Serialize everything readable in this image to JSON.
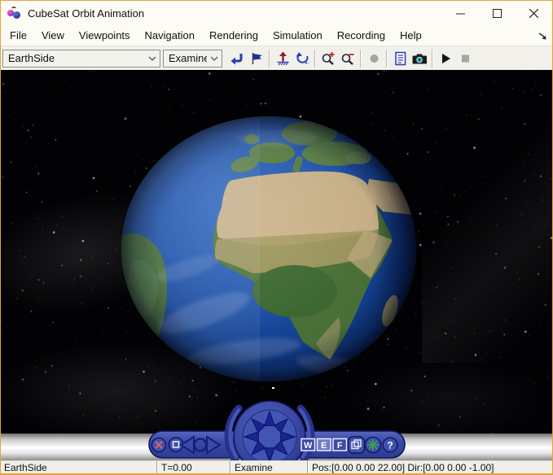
{
  "window": {
    "title": "CubeSat Orbit Animation",
    "app_icon": "simulink-3d-animation-cherries-icon",
    "controls": [
      "minimize",
      "maximize",
      "close"
    ]
  },
  "menu": {
    "items": [
      "File",
      "View",
      "Viewpoints",
      "Navigation",
      "Rendering",
      "Simulation",
      "Recording",
      "Help"
    ],
    "overflow_icon": "collapse-pane-arrow-icon"
  },
  "toolbar": {
    "viewpoint_combo": {
      "value": "EarthSide"
    },
    "navigation_combo": {
      "value": "Examine"
    },
    "buttons": [
      "return-to-viewpoint-icon",
      "create-viewpoint-flag-icon",
      "straighten-up-icon",
      "undo-move-icon",
      "zoom-in-icon",
      "zoom-out-icon",
      "record-icon",
      "world-info-icon",
      "capture-frame-camera-icon",
      "play-icon",
      "stop-icon"
    ]
  },
  "viewport": {
    "scene": "earth-globe-over-starfield",
    "console": {
      "left_buttons": [
        "close-console",
        "restore-view",
        "pan-left",
        "center-dot",
        "pan-right"
      ],
      "wef_labels": [
        "W",
        "E",
        "F"
      ],
      "pressed_button": "E",
      "right_buttons": [
        "cube-view",
        "home-splat",
        "help"
      ],
      "help_label": "?"
    }
  },
  "statusbar": {
    "viewpoint": "EarthSide",
    "time": "T=0.00",
    "navigation_mode": "Examine",
    "camera": "Pos:[0.00 0.00 22.00] Dir:[0.00 0.00 -1.00]"
  },
  "colors": {
    "window_border": "#E7A23B",
    "titlebar_bg": "#FDFCF4",
    "toolbar_bg": "#F1F0EA",
    "console_blue": "#3B4AA6",
    "console_dark": "#10165E",
    "ocean_blue": "#1A4C9E",
    "desert_tan": "#CDB48A",
    "land_green": "#4C7339",
    "icon_blue": "#2A3AB8",
    "accent_red": "#C42222"
  }
}
